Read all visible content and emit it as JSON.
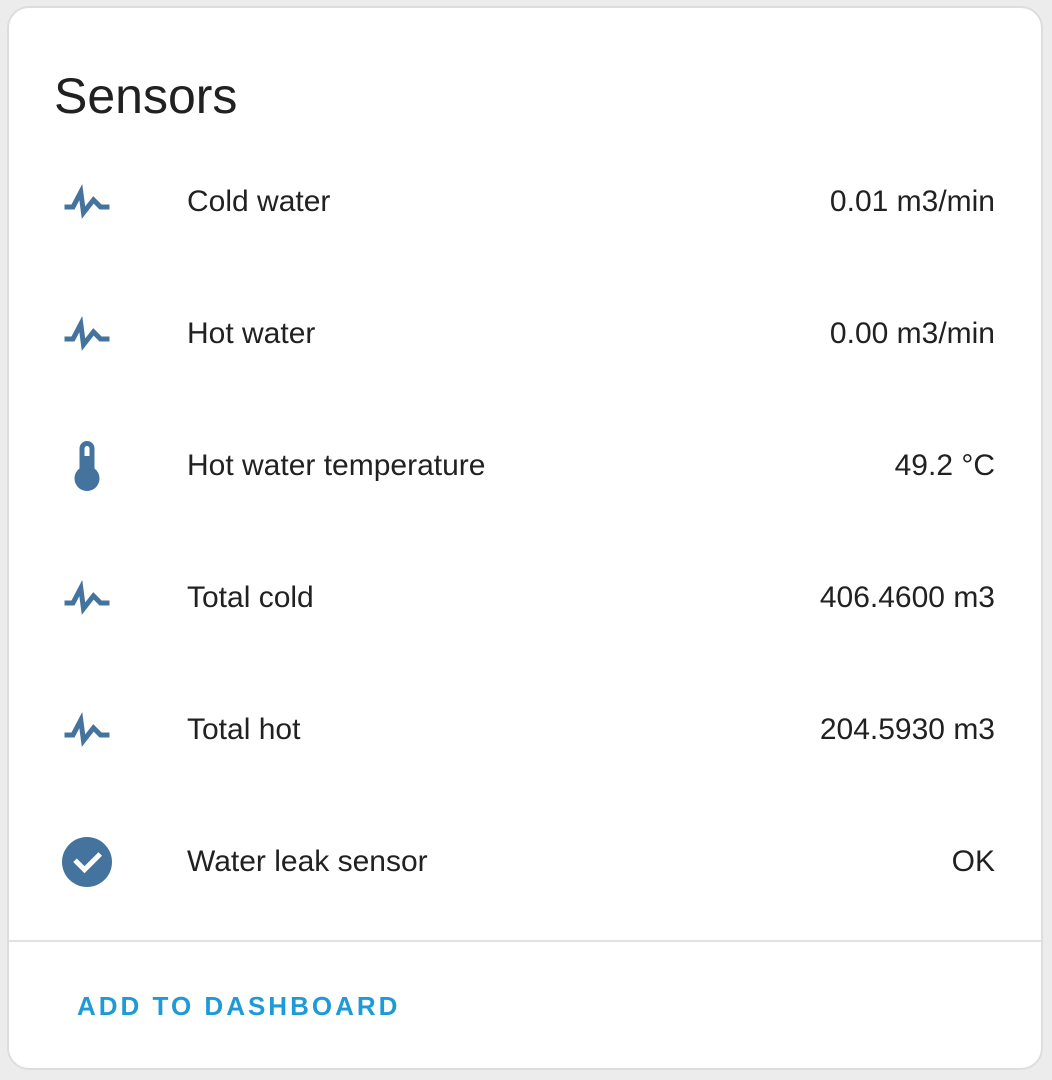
{
  "card": {
    "title": "Sensors"
  },
  "sensors": [
    {
      "icon": "pulse-icon",
      "label": "Cold water",
      "value": "0.01 m3/min"
    },
    {
      "icon": "pulse-icon",
      "label": "Hot water",
      "value": "0.00 m3/min"
    },
    {
      "icon": "thermometer-icon",
      "label": "Hot water temperature",
      "value": "49.2 °C"
    },
    {
      "icon": "pulse-icon",
      "label": "Total cold",
      "value": "406.4600 m3"
    },
    {
      "icon": "pulse-icon",
      "label": "Total hot",
      "value": "204.5930 m3"
    },
    {
      "icon": "check-circle-icon",
      "label": "Water leak sensor",
      "value": "OK"
    }
  ],
  "footer": {
    "add_label": "ADD TO DASHBOARD"
  },
  "colors": {
    "icon": "#44739e",
    "accent": "#1e9bd7",
    "text": "#212121",
    "divider": "#e2e2e2"
  }
}
